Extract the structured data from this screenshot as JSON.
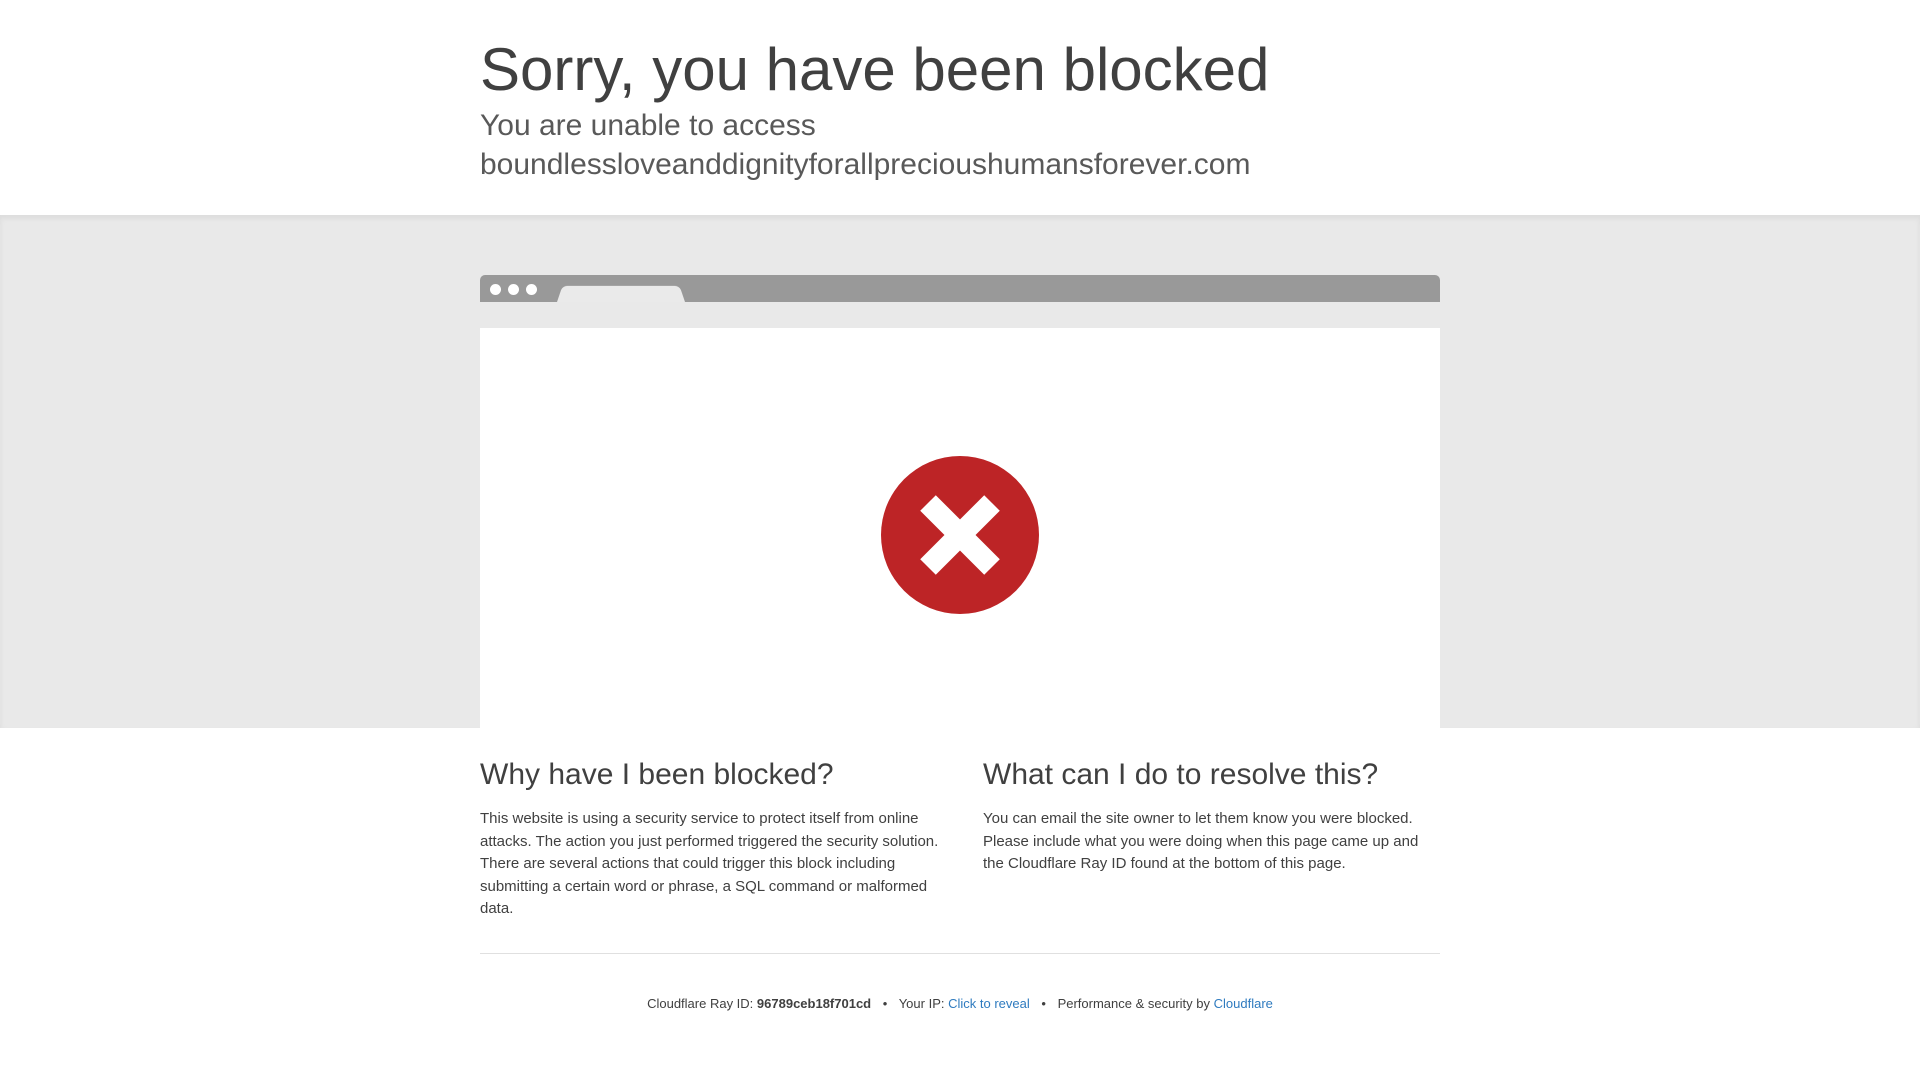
{
  "header": {
    "title": "Sorry, you have been blocked",
    "subtitle_prefix": "You are unable to access",
    "domain": "boundlessloveanddignityforallprecioushumansforever.com"
  },
  "icon": {
    "name": "blocked-x-icon",
    "color": "#bd2426"
  },
  "why": {
    "heading": "Why have I been blocked?",
    "body": "This website is using a security service to protect itself from online attacks. The action you just performed triggered the security solution. There are several actions that could trigger this block including submitting a certain word or phrase, a SQL command or malformed data."
  },
  "resolve": {
    "heading": "What can I do to resolve this?",
    "body": "You can email the site owner to let them know you were blocked. Please include what you were doing when this page came up and the Cloudflare Ray ID found at the bottom of this page."
  },
  "footer": {
    "ray_label": "Cloudflare Ray ID:",
    "ray_id": "96789ceb18f701cd",
    "ip_label": "Your IP:",
    "ip_link": "Click to reveal",
    "perf_label": "Performance & security by",
    "cloudflare_link": "Cloudflare",
    "separator": "•",
    "link_color": "#2f7bbf"
  }
}
